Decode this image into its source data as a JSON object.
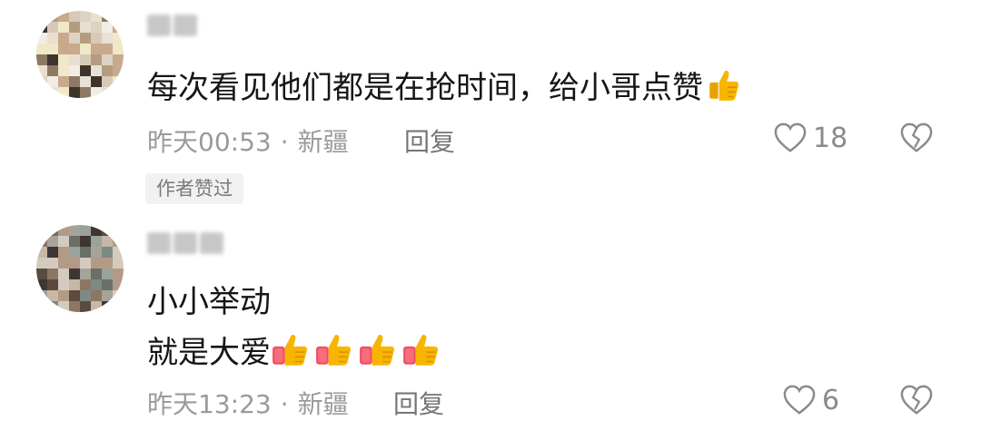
{
  "comments": [
    {
      "username": "",
      "text": "每次看见他们都是在抢时间，给小哥点赞",
      "emoji": "thumbs-up",
      "time": "昨天00:53",
      "separator": "·",
      "location": "新疆",
      "reply_label": "回复",
      "like_count": "18",
      "badge": "作者赞过",
      "avatar_palette": [
        "#e8e1d6",
        "#d8c9b6",
        "#8d7a64",
        "#3d342c",
        "#c9a98c",
        "#eadfcf",
        "#f2ede4",
        "#b59c80",
        "#dcd4c3",
        "#f0e8c8"
      ]
    },
    {
      "username": "",
      "text_line1": "小小举动",
      "text_line2": "就是大爱",
      "emoji": "thumbs-up",
      "emoji_count": 4,
      "time": "昨天13:23",
      "separator": "·",
      "location": "新疆",
      "reply_label": "回复",
      "like_count": "6",
      "avatar_palette": [
        "#7d8a83",
        "#a6a49a",
        "#5c4a3f",
        "#8e7665",
        "#b39a86",
        "#3e3632",
        "#c6b8a6",
        "#6a6f68",
        "#9aa39b",
        "#d4cbbf"
      ]
    }
  ],
  "colors": {
    "primary_text": "#161616",
    "meta_text": "#9a9a9a",
    "badge_bg": "#f1f1f1",
    "emoji_yellow": "#f7b500",
    "emoji_sleeve": "#f04f63"
  }
}
